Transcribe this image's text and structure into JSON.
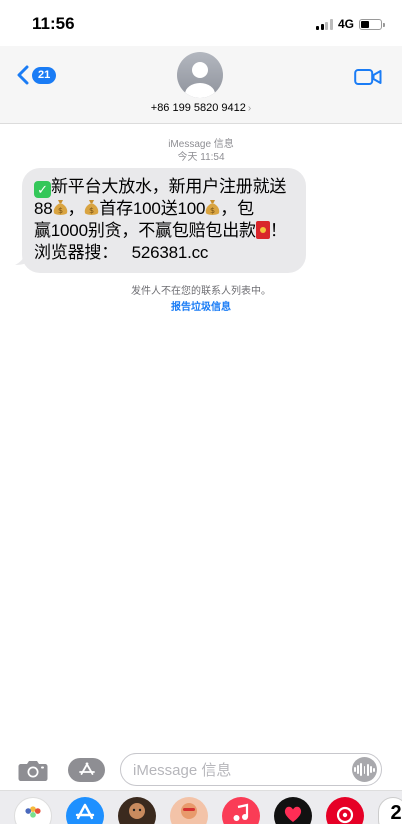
{
  "status_bar": {
    "time": "11:56",
    "network": "4G"
  },
  "header": {
    "back_count": "21",
    "contact": "+86 199 5820 9412",
    "contact_chevron": "›"
  },
  "conversation": {
    "service_label": "iMessage 信息",
    "timestamp": "今天 11:54",
    "message": {
      "line1": "新平台大放水，新用户注册就送",
      "line2_a": "88",
      "line2_b": "，",
      "line2_c": "首存100送100",
      "line2_d": "，包",
      "line3_a": "赢1000别贪，不赢包赔包出款",
      "line3_b": "！",
      "line4": "浏览器搜：   526381.cc"
    },
    "notice": "发件人不在您的联系人列表中。",
    "report_link": "报告垃圾信息"
  },
  "composer": {
    "placeholder": "iMessage 信息"
  },
  "app_drawer": {
    "apps": [
      "photos-app",
      "app-store-app",
      "memoji-app",
      "memoji-app-2",
      "music-app",
      "digital-touch-app",
      "netease-music-app",
      "more-app"
    ],
    "partial_label": "2"
  },
  "colors": {
    "accent_blue": "#1a7cf5",
    "bubble_gray": "#e9e9eb",
    "header_bg": "#f6f6f6"
  },
  "icons": [
    "signal-icon",
    "battery-icon",
    "back-chevron-icon",
    "avatar-icon",
    "video-call-icon",
    "check-emoji-icon",
    "money-bag-emoji-icon",
    "red-envelope-emoji-icon",
    "camera-icon",
    "app-store-icon",
    "audio-waveform-icon"
  ]
}
